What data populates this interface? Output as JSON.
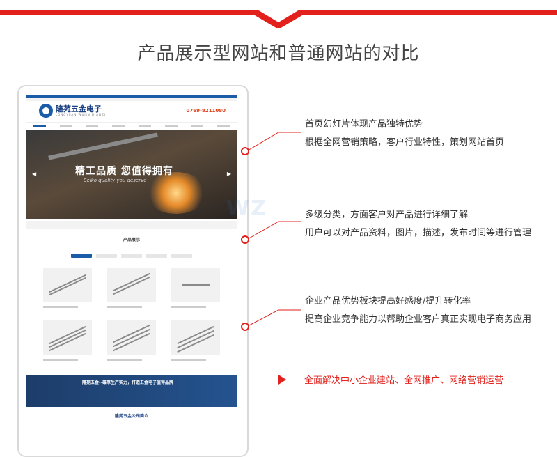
{
  "page": {
    "title": "产品展示型网站和普通网站的对比",
    "accent_color": "#e2211c"
  },
  "mockup": {
    "logo_text": "隆苑五金电子",
    "logo_sub": "LONGYUAN WUJIN DIANZI",
    "phone": "0769-8211080",
    "banner_title": "精工品质 您值得拥有",
    "banner_sub": "Seiko quality you deserve",
    "section_title": "产品展示",
    "footer_banner_text": "隆苑五金--雄厚生产实力，打造五金电子值得品牌",
    "company_title": "隆苑五金公司简介"
  },
  "callouts": [
    {
      "line1": "首页幻灯片体现产品独特优势",
      "line2": "根据全网营销策略，客户行业特性，策划网站首页"
    },
    {
      "line1": "多级分类，方面客户对产品进行详细了解",
      "line2": "用户可以对产品资料，图片，描述，发布时间等进行管理"
    },
    {
      "line1": "企业产品优势板块提高好感度/提升转化率",
      "line2": "提高企业竞争能力以帮助企业客户真正实现电子商务应用"
    }
  ],
  "cta": {
    "text": "全面解决中小企业建站、全网推广、网络营销运营"
  }
}
